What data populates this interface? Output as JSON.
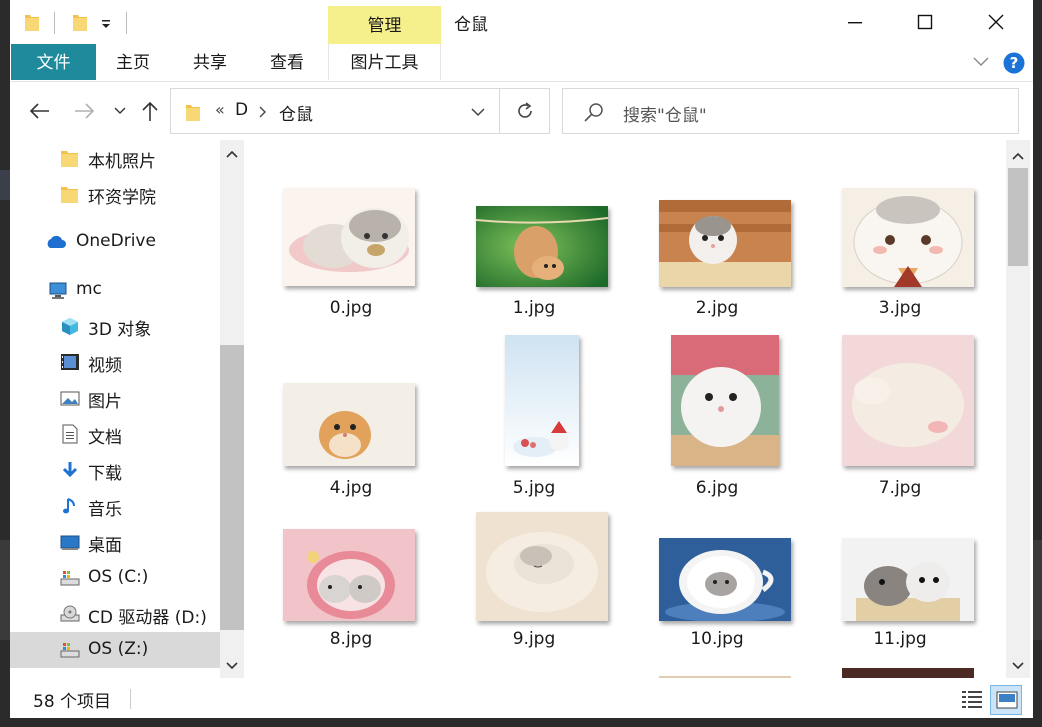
{
  "window": {
    "title": "仓鼠",
    "manage_tab": "管理"
  },
  "ribbon": {
    "tabs": [
      "文件",
      "主页",
      "共享",
      "查看"
    ],
    "contextual_tab": "图片工具"
  },
  "address": {
    "overflow": "«",
    "crumbs": [
      "D",
      "仓鼠"
    ],
    "search_placeholder": "搜索\"仓鼠\""
  },
  "nav": {
    "items": [
      {
        "label": "本机照片",
        "icon": "folder-icon"
      },
      {
        "label": "环资学院",
        "icon": "folder-icon"
      },
      {
        "label": "OneDrive",
        "icon": "cloud-icon"
      },
      {
        "label": "mc",
        "icon": "computer-icon"
      },
      {
        "label": "3D 对象",
        "icon": "cube-icon"
      },
      {
        "label": "视频",
        "icon": "video-icon"
      },
      {
        "label": "图片",
        "icon": "picture-icon"
      },
      {
        "label": "文档",
        "icon": "document-icon"
      },
      {
        "label": "下载",
        "icon": "download-icon"
      },
      {
        "label": "音乐",
        "icon": "music-icon"
      },
      {
        "label": "桌面",
        "icon": "desktop-icon"
      },
      {
        "label": "OS (C:)",
        "icon": "drive-icon"
      },
      {
        "label": "CD 驱动器 (D:)",
        "icon": "cd-drive-icon"
      },
      {
        "label": "OS (Z:)",
        "icon": "drive-icon"
      }
    ],
    "selected": "OS (Z:)"
  },
  "files": [
    {
      "name": "0.jpg",
      "theme": "drawn-hamster-pink"
    },
    {
      "name": "1.jpg",
      "theme": "hamster-on-rope-green"
    },
    {
      "name": "2.jpg",
      "theme": "hamster-in-wood-box"
    },
    {
      "name": "3.jpg",
      "theme": "drawn-hamster-face"
    },
    {
      "name": "4.jpg",
      "theme": "orange-hamster-white"
    },
    {
      "name": "5.jpg",
      "theme": "snowy-illustration"
    },
    {
      "name": "6.jpg",
      "theme": "white-hamster-cage"
    },
    {
      "name": "7.jpg",
      "theme": "sleeping-hamster-pink"
    },
    {
      "name": "8.jpg",
      "theme": "hamsters-in-pink-cup"
    },
    {
      "name": "9.jpg",
      "theme": "sleeping-hamster-cream"
    },
    {
      "name": "10.jpg",
      "theme": "hamster-in-teacup-blue"
    },
    {
      "name": "11.jpg",
      "theme": "two-hamsters-pot"
    }
  ],
  "status": {
    "count_text": "58 个项目"
  },
  "colors": {
    "file_tab": "#1e8a9c",
    "manage_tab": "#f5ef8c",
    "selected_nav": "#d9d9d9",
    "help": "#1a73d9"
  }
}
